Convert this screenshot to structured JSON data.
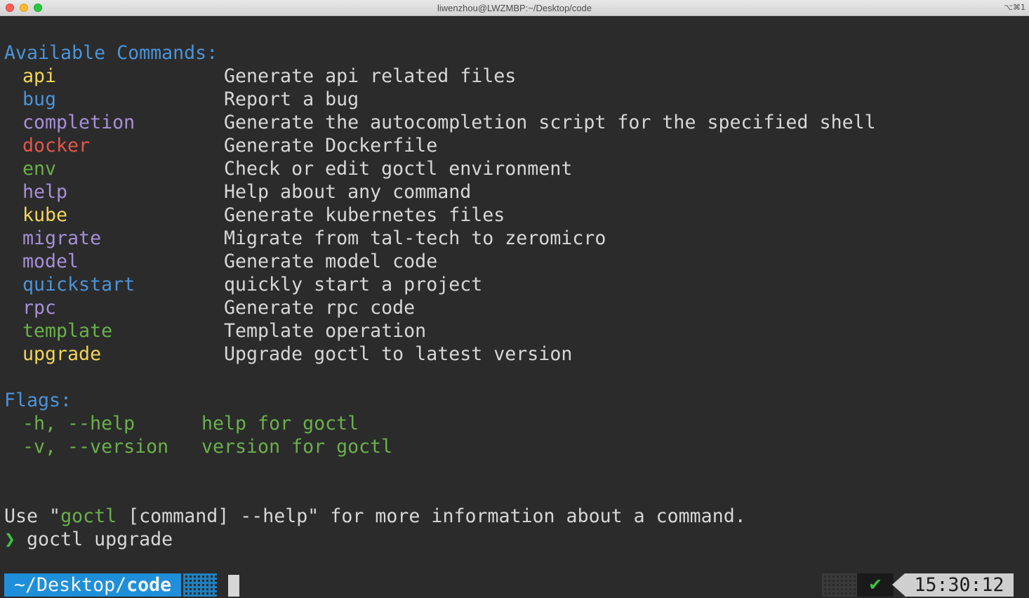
{
  "window": {
    "title": "liwenzhou@LWZMBP:~/Desktop/code",
    "shortcut": "⌥⌘1"
  },
  "available_commands": {
    "heading": "Available Commands:",
    "items": [
      {
        "name": "api",
        "color": "#f3d55b",
        "desc": "Generate api related files"
      },
      {
        "name": "bug",
        "color": "#4b93d8",
        "desc": "Report a bug"
      },
      {
        "name": "completion",
        "color": "#a68fd8",
        "desc": "Generate the autocompletion script for the specified shell"
      },
      {
        "name": "docker",
        "color": "#e3574b",
        "desc": "Generate Dockerfile"
      },
      {
        "name": "env",
        "color": "#6ab04c",
        "desc": "Check or edit goctl environment"
      },
      {
        "name": "help",
        "color": "#a68fd8",
        "desc": "Help about any command"
      },
      {
        "name": "kube",
        "color": "#f3d55b",
        "desc": "Generate kubernetes files"
      },
      {
        "name": "migrate",
        "color": "#a68fd8",
        "desc": "Migrate from tal-tech to zeromicro"
      },
      {
        "name": "model",
        "color": "#a68fd8",
        "desc": "Generate model code"
      },
      {
        "name": "quickstart",
        "color": "#4b93d8",
        "desc": "quickly start a project"
      },
      {
        "name": "rpc",
        "color": "#a68fd8",
        "desc": "Generate rpc code"
      },
      {
        "name": "template",
        "color": "#6ab04c",
        "desc": "Template operation"
      },
      {
        "name": "upgrade",
        "color": "#f3d55b",
        "desc": "Upgrade goctl to latest version"
      }
    ]
  },
  "flags": {
    "heading": "Flags:",
    "items": [
      {
        "name": "-h, --help",
        "desc": "help for goctl"
      },
      {
        "name": "-v, --version",
        "desc": "version for goctl"
      }
    ]
  },
  "usage": {
    "prefix": "Use \"",
    "command": "goctl",
    "suffix": " [command] --help\" for more information about a command."
  },
  "prompt": {
    "symbol": "❯",
    "command": "goctl upgrade"
  },
  "statusbar": {
    "path_prefix": "~/Desktop/",
    "path_current": "code",
    "status_icon": "✔",
    "time": "15:30:12"
  }
}
